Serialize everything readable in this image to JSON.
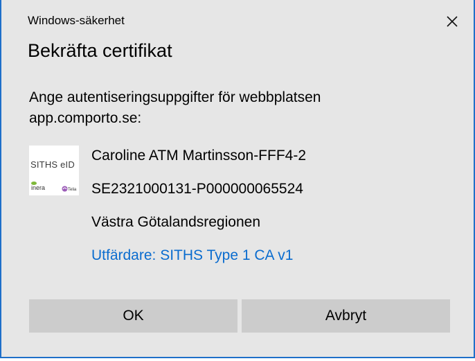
{
  "window": {
    "title": "Windows-säkerhet",
    "close_icon": "close-icon"
  },
  "dialog": {
    "heading": "Bekräfta certifikat",
    "prompt": "Ange autentiseringsuppgifter för webbplatsen app.comporto.se:"
  },
  "certificate": {
    "logo": {
      "brand": "SITHS eID",
      "inera": "inera",
      "telia": "Telia"
    },
    "name": "Caroline ATM Martinsson-FFF4-2",
    "serial": "SE2321000131-P000000065524",
    "organization": "Västra Götalandsregionen",
    "issuer": "Utfärdare: SITHS Type 1 CA v1"
  },
  "buttons": {
    "ok": "OK",
    "cancel": "Avbryt"
  },
  "colors": {
    "dialog_background": "#e6e6e6",
    "border_accent": "#1e6fc9",
    "link": "#0a6ccf",
    "button_background": "#cccccc"
  }
}
